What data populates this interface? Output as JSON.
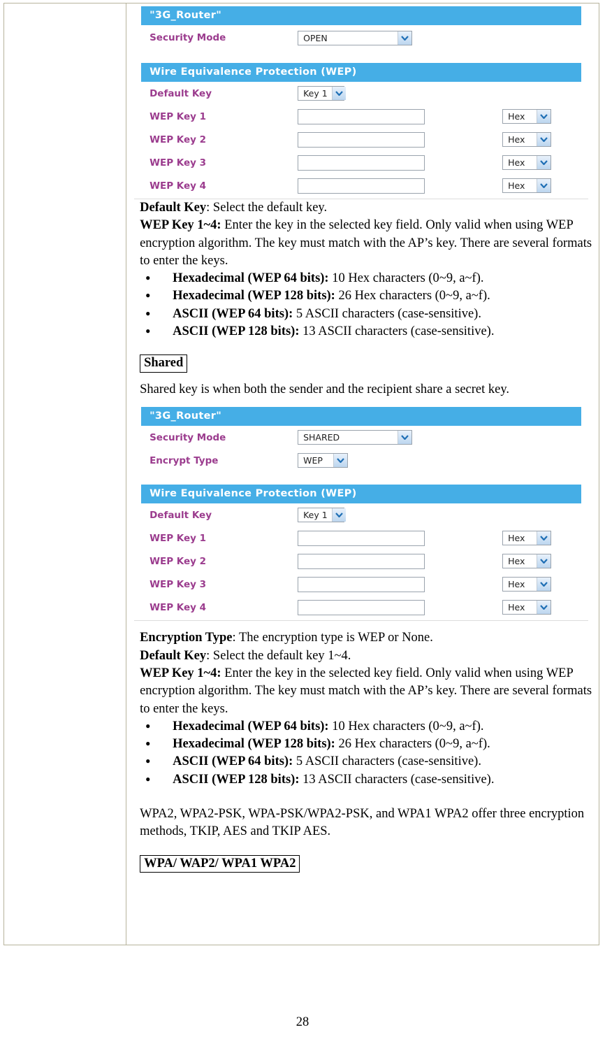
{
  "page": {
    "number": "28"
  },
  "panel_open": {
    "title": "\"3G_Router\"",
    "security_mode_label": "Security Mode",
    "security_mode_value": "OPEN",
    "wep_section_title": "Wire Equivalence Protection (WEP)",
    "default_key_label": "Default Key",
    "default_key_value": "Key 1",
    "keys": [
      {
        "label": "WEP Key 1",
        "value": "",
        "format": "Hex"
      },
      {
        "label": "WEP Key 2",
        "value": "",
        "format": "Hex"
      },
      {
        "label": "WEP Key 3",
        "value": "",
        "format": "Hex"
      },
      {
        "label": "WEP Key 4",
        "value": "",
        "format": "Hex"
      }
    ]
  },
  "panel_shared": {
    "title": "\"3G_Router\"",
    "security_mode_label": "Security Mode",
    "security_mode_value": "SHARED",
    "encrypt_type_label": "Encrypt Type",
    "encrypt_type_value": "WEP",
    "wep_section_title": "Wire Equivalence Protection (WEP)",
    "default_key_label": "Default Key",
    "default_key_value": "Key 1",
    "keys": [
      {
        "label": "WEP Key 1",
        "value": "",
        "format": "Hex"
      },
      {
        "label": "WEP Key 2",
        "value": "",
        "format": "Hex"
      },
      {
        "label": "WEP Key 3",
        "value": "",
        "format": "Hex"
      },
      {
        "label": "WEP Key 4",
        "value": "",
        "format": "Hex"
      }
    ]
  },
  "text_open": {
    "default_key_term": "Default Key",
    "default_key_desc": ": Select the default key.",
    "wep_key_term": "WEP Key 1~4:",
    "wep_key_desc": " Enter the key in the selected key field. Only valid when using WEP encryption algorithm. The key must match with the AP’s key. There are several formats to enter the keys.",
    "bullets": [
      {
        "term": "Hexadecimal (WEP 64 bits):",
        "desc": " 10 Hex characters (0~9, a~f)."
      },
      {
        "term": "Hexadecimal (WEP 128 bits):",
        "desc": " 26 Hex characters (0~9, a~f)."
      },
      {
        "term": "ASCII (WEP 64 bits):",
        "desc": " 5 ASCII characters (case-sensitive)."
      },
      {
        "term": "ASCII (WEP 128 bits):",
        "desc": " 13 ASCII characters (case-sensitive)."
      }
    ]
  },
  "shared_section": {
    "heading": "Shared",
    "intro": "Shared key is when both the sender and the recipient share a secret key."
  },
  "text_shared": {
    "encryption_type_term": "Encryption Type",
    "encryption_type_desc": ": The encryption type is WEP or None.",
    "default_key_term": "Default Key",
    "default_key_desc": ": Select the default key 1~4.",
    "wep_key_term": "WEP Key 1~4:",
    "wep_key_desc": " Enter the key in the selected key field. Only valid when using WEP encryption algorithm. The key must match with the AP’s key. There are several formats to enter the keys.",
    "bullets": [
      {
        "term": "Hexadecimal (WEP 64 bits):",
        "desc": " 10 Hex characters (0~9, a~f)."
      },
      {
        "term": "Hexadecimal (WEP 128 bits):",
        "desc": " 26 Hex characters (0~9, a~f)."
      },
      {
        "term": "ASCII (WEP 64 bits):",
        "desc": " 5 ASCII characters (case-sensitive)."
      },
      {
        "term": "ASCII (WEP 128 bits):",
        "desc": " 13 ASCII characters (case-sensitive)."
      }
    ]
  },
  "wpa_section": {
    "paragraph": "WPA2, WPA2-PSK, WPA-PSK/WPA2-PSK, and WPA1 WPA2 offer three encryption methods, TKIP, AES and TKIP AES.",
    "heading": "WPA/ WAP2/ WPA1 WPA2"
  },
  "colors": {
    "bar_blue": "#45AEE6",
    "label_purple": "#9B3C8E",
    "table_border": "#b7b39c"
  }
}
